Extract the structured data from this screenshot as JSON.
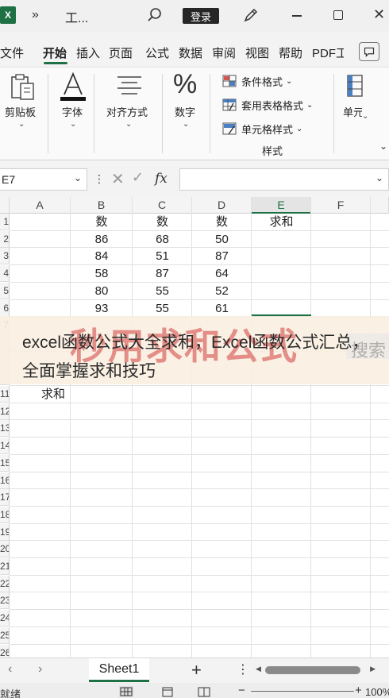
{
  "titlebar": {
    "app_logo": "X",
    "more_glyph": "»",
    "title": "工...",
    "login_label": "登录",
    "close_glyph": "✕"
  },
  "tabs": [
    "文件",
    "开始",
    "插入",
    "页面",
    "公式",
    "数据",
    "审阅",
    "视图",
    "帮助",
    "PDF工"
  ],
  "active_tab": "开始",
  "ribbon": {
    "clipboard": "剪贴板",
    "font": "字体",
    "align": "对齐方式",
    "number": "数字",
    "number_glyph": "%",
    "cond_format": "条件格式",
    "table_format": "套用表格格式",
    "cell_style": "单元格样式",
    "styles_group": "样式",
    "cells": "单元"
  },
  "formula_bar": {
    "name_box": "E7",
    "fx": "fx",
    "value": ""
  },
  "grid": {
    "columns": [
      "A",
      "B",
      "C",
      "D",
      "E",
      "F"
    ],
    "selected_column": "E",
    "row_numbers": [
      "1",
      "2",
      "3",
      "4",
      "5",
      "6",
      "7",
      "",
      "",
      "",
      "11",
      "12",
      "13",
      "14",
      "15",
      "16",
      "17",
      "18",
      "19",
      "20",
      "21",
      "22",
      "23",
      "24",
      "25",
      "26"
    ],
    "rows": [
      [
        "",
        "数",
        "数",
        "数",
        "求和",
        ""
      ],
      [
        "",
        "86",
        "68",
        "50",
        "",
        ""
      ],
      [
        "",
        "84",
        "51",
        "87",
        "",
        ""
      ],
      [
        "",
        "58",
        "87",
        "64",
        "",
        ""
      ],
      [
        "",
        "80",
        "55",
        "52",
        "",
        ""
      ],
      [
        "",
        "93",
        "55",
        "61",
        "",
        ""
      ]
    ],
    "row11_label": "求和"
  },
  "overlay": {
    "title": "excel函数公式大全求和，Excel函数公式汇总，全面掌握求和技巧",
    "watermark": "秒用求和公式",
    "search_text": "搜索"
  },
  "sheets": {
    "tabs": [
      "Sheet1"
    ],
    "add_glyph": "+",
    "more_glyph": "⋮"
  },
  "status": {
    "ready": "就绪",
    "zoom": "100%",
    "minus": "−",
    "plus": "+"
  },
  "colors": {
    "accent": "#1e7145"
  }
}
